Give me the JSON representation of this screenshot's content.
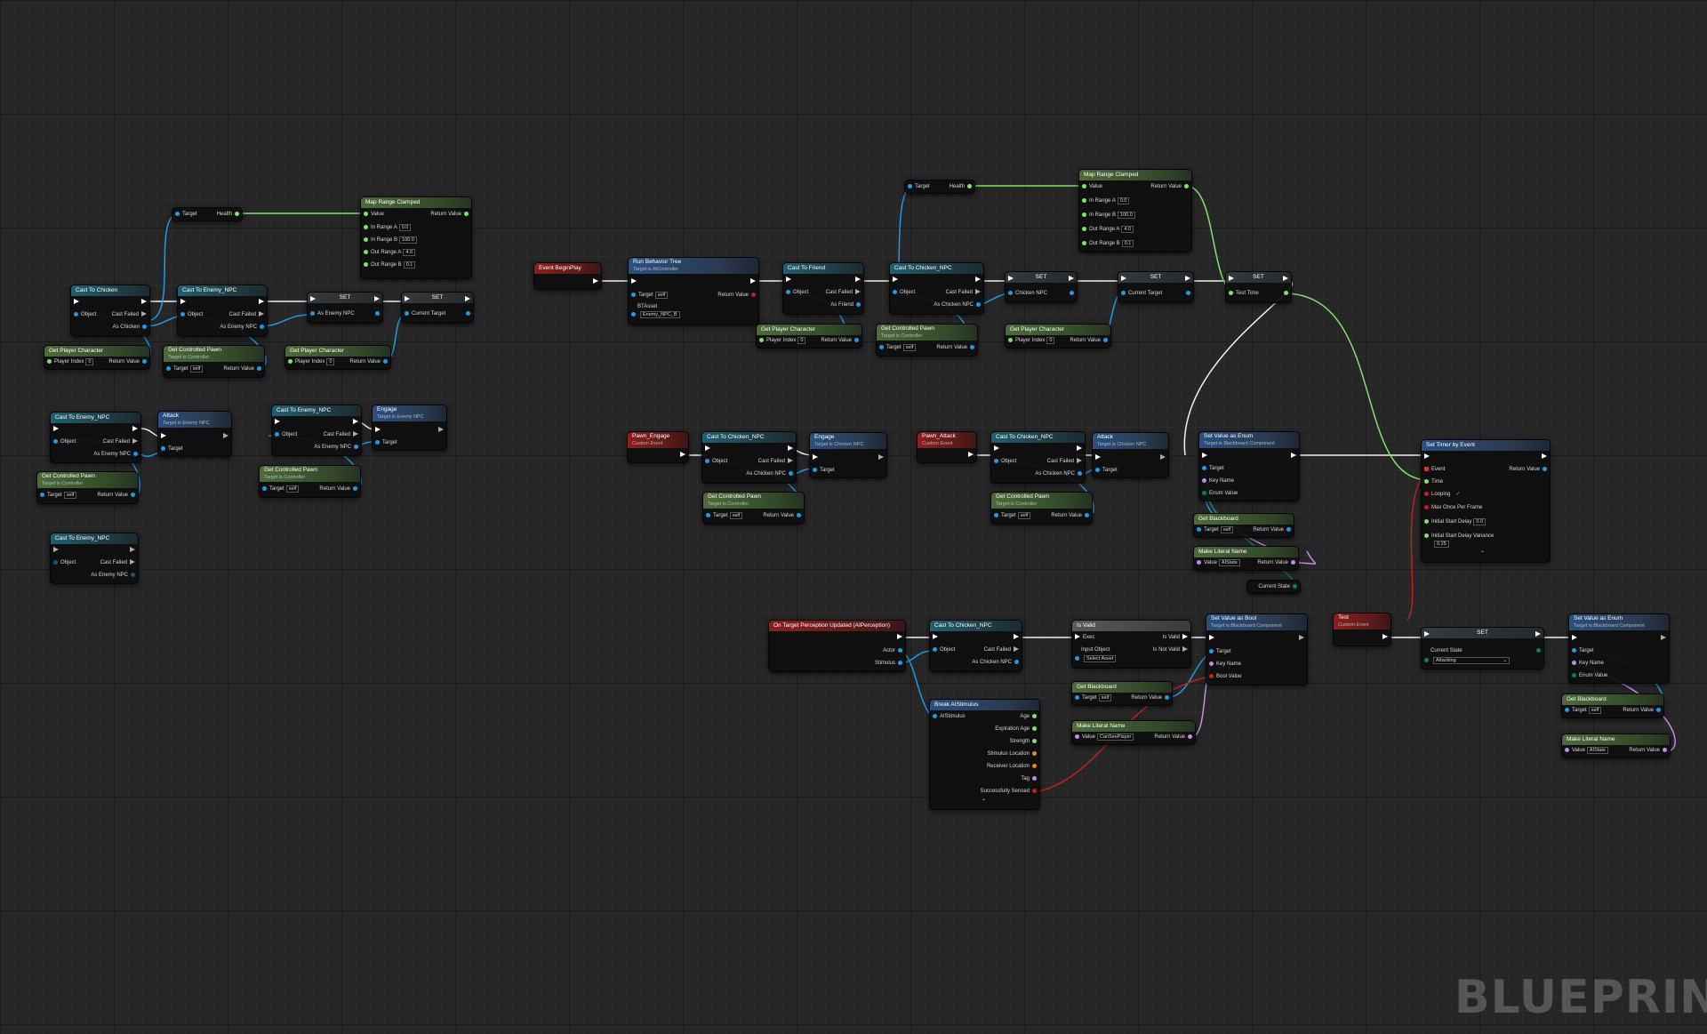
{
  "watermark": "BLUEPRINT",
  "labels": {
    "target": "Target",
    "health": "Health",
    "map_range": "Map Range Clamped",
    "value": "Value",
    "return_value": "Return Value",
    "in_range_a": "In Range A",
    "in_range_b": "In Range B",
    "out_range_a": "Out Range A",
    "out_range_b": "Out Range B",
    "cast_to_chicken": "Cast To Chicken",
    "cast_to_enemy": "Cast To Enemy_NPC",
    "cast_to_friend": "Cast To Friend",
    "cast_to_chicken_npc": "Cast To Chicken_NPC",
    "object": "Object",
    "cast_failed": "Cast Failed",
    "as_chicken": "As Chicken",
    "as_enemy": "As Enemy NPC",
    "as_friend": "As Friend",
    "as_chicken_npc": "As Chicken NPC",
    "set": "SET",
    "current_target": "Current Target",
    "chicken_npc": "Chicken NPC",
    "test_time": "Test Time",
    "get_player_character": "Get Player Character",
    "player_index": "Player Index",
    "get_controlled_pawn": "Get Controlled Pawn",
    "target_is_controller": "Target is Controller",
    "attack": "Attack",
    "engage": "Engage",
    "target_is_enemy": "Target is Enemy NPC",
    "target_is_chicken": "Target is Chicken NPC",
    "event_begin_play": "Event BeginPlay",
    "run_behavior_tree": "Run Behavior Tree",
    "target_is_ai": "Target is AIController",
    "bt_asset": "BTAsset",
    "bt_value": "Enemy_NPC_B",
    "pawn_engage": "Pawn_Engage",
    "pawn_attack": "Pawn_Attack",
    "custom_event": "Custom Event",
    "set_value_as_enum": "Set Value as Enum",
    "set_value_as_bool": "Set Value as Bool",
    "target_is_bb": "Target is Blackboard Component",
    "key_name": "Key Name",
    "enum_value": "Enum Value",
    "bool_value": "Bool Value",
    "get_blackboard": "Get Blackboard",
    "make_literal_name": "Make Literal Name",
    "current_state": "Current State",
    "set_timer": "Set Timer by Event",
    "event": "Event",
    "time": "Time",
    "looping": "Looping",
    "max_once": "Max Once Per Frame",
    "initial_start_delay": "Initial Start Delay",
    "initial_start_delay_variance": "Initial Start Delay Variance",
    "on_target_perception": "On Target Perception Updated (AIPerception)",
    "actor": "Actor",
    "stimulus": "Stimulus",
    "is_valid": "Is Valid",
    "exec": "Exec",
    "input_object": "Input Object",
    "is_not_valid": "Is Not Valid",
    "select_asset": "Select Asset",
    "break_stimulus": "Break AIStimulus",
    "ai_stimulus": "AIStimulus",
    "age": "Age",
    "expiration_age": "Expiration Age",
    "strength": "Strength",
    "stimulus_location": "Stimulus Location",
    "receiver_location": "Receiver Location",
    "tag": "Tag",
    "successfully_sensed": "Successfully Sensed",
    "test": "Test",
    "attacking": "Attacking",
    "ai_state": "AIState",
    "can_see_player": "CanSeePlayer",
    "self": "self"
  },
  "values": {
    "zero": "0",
    "one_hundred": "100.0",
    "zero_f": "0.0",
    "four": "4.0",
    "point_one": "0.1",
    "point_two_five": "0.25"
  }
}
